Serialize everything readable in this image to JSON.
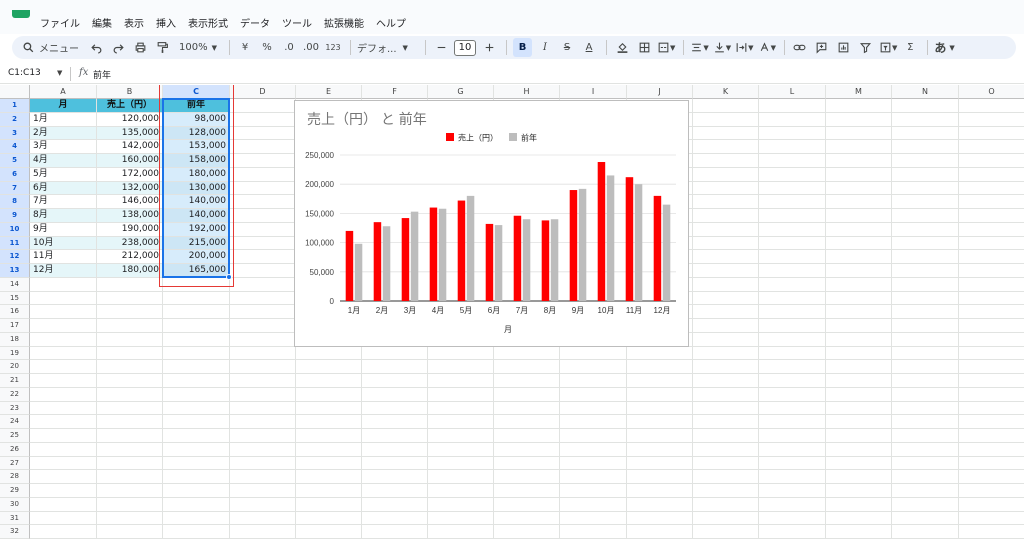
{
  "menu": {
    "items": [
      "ファイル",
      "編集",
      "表示",
      "挿入",
      "表示形式",
      "データ",
      "ツール",
      "拡張機能",
      "ヘルプ"
    ]
  },
  "toolbar": {
    "search_label": "メニュー",
    "zoom": "100%",
    "currency": "¥",
    "percent": "%",
    "dec_decrease": ".0",
    "dec_increase": ".00",
    "number_format": "123",
    "font": "デフォ...",
    "font_size": "10",
    "bold": "B",
    "italic": "I",
    "strike": "S",
    "text_color": "A",
    "input_tools": "あ",
    "sigma": "Σ"
  },
  "formula_bar": {
    "name_box": "C1:C13",
    "fx": "fx",
    "value": "前年"
  },
  "columns": [
    "A",
    "B",
    "C",
    "D",
    "E",
    "F",
    "G",
    "H",
    "I",
    "J",
    "K",
    "L",
    "M",
    "N",
    "O"
  ],
  "rows": [
    "1",
    "2",
    "3",
    "4",
    "5",
    "6",
    "7",
    "8",
    "9",
    "10",
    "11",
    "12",
    "13",
    "14",
    "15",
    "16",
    "17",
    "18",
    "19",
    "20",
    "21",
    "22",
    "23",
    "24",
    "25",
    "26",
    "27",
    "28",
    "29",
    "30",
    "31",
    "32"
  ],
  "table": {
    "headers": [
      "月",
      "売上（円）",
      "前年"
    ],
    "rows": [
      [
        "1月",
        "120,000",
        "98,000"
      ],
      [
        "2月",
        "135,000",
        "128,000"
      ],
      [
        "3月",
        "142,000",
        "153,000"
      ],
      [
        "4月",
        "160,000",
        "158,000"
      ],
      [
        "5月",
        "172,000",
        "180,000"
      ],
      [
        "6月",
        "132,000",
        "130,000"
      ],
      [
        "7月",
        "146,000",
        "140,000"
      ],
      [
        "8月",
        "138,000",
        "140,000"
      ],
      [
        "9月",
        "190,000",
        "192,000"
      ],
      [
        "10月",
        "238,000",
        "215,000"
      ],
      [
        "11月",
        "212,000",
        "200,000"
      ],
      [
        "12月",
        "180,000",
        "165,000"
      ]
    ]
  },
  "colors": {
    "series_current": "#ff0000",
    "series_previous": "#bdbdbd",
    "header_fill": "#4ec0dd",
    "selection": "#1a73e8"
  },
  "chart_data": {
    "type": "bar",
    "title": "売上（円） と 前年",
    "xlabel": "月",
    "ylabel": "",
    "categories": [
      "1月",
      "2月",
      "3月",
      "4月",
      "5月",
      "6月",
      "7月",
      "8月",
      "9月",
      "10月",
      "11月",
      "12月"
    ],
    "series": [
      {
        "name": "売上（円）",
        "values": [
          120000,
          135000,
          142000,
          160000,
          172000,
          132000,
          146000,
          138000,
          190000,
          238000,
          212000,
          180000
        ]
      },
      {
        "name": "前年",
        "values": [
          98000,
          128000,
          153000,
          158000,
          180000,
          130000,
          140000,
          140000,
          192000,
          215000,
          200000,
          165000
        ]
      }
    ],
    "ylim": [
      0,
      250000
    ],
    "yticks": [
      "0",
      "50,000",
      "100,000",
      "150,000",
      "200,000",
      "250,000"
    ],
    "grid": true,
    "legend": "top"
  }
}
